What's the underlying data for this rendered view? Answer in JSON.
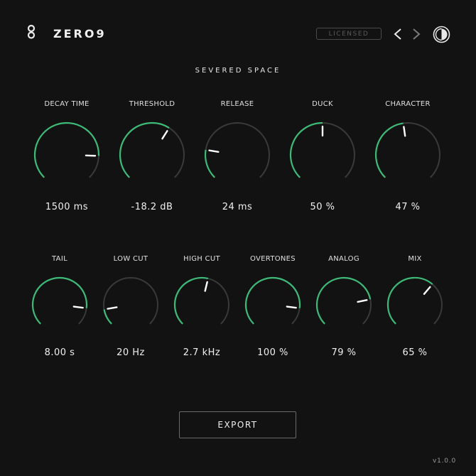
{
  "header": {
    "brand": "ZERO9",
    "license_badge": "LICENSED",
    "logo_icon": "infinity-logo-icon",
    "prev_icon": "chevron-left-icon",
    "next_icon": "chevron-right-icon",
    "theme_icon": "half-circle-theme-icon"
  },
  "preset": {
    "name": "SEVERED SPACE"
  },
  "colors": {
    "accent": "#3dba78",
    "track": "#3a3a3a",
    "background": "#121212",
    "pointer": "#ffffff"
  },
  "knobs_row1": [
    {
      "label": "DECAY TIME",
      "value": "1500 ms",
      "level": 0.84
    },
    {
      "label": "THRESHOLD",
      "value": "-18.2 dB",
      "level": 0.62
    },
    {
      "label": "RELEASE",
      "value": "24 ms",
      "level": 0.2
    },
    {
      "label": "DUCK",
      "value": "50 %",
      "level": 0.5
    },
    {
      "label": "CHARACTER",
      "value": "47 %",
      "level": 0.47
    }
  ],
  "knobs_row2": [
    {
      "label": "TAIL",
      "value": "8.00 s",
      "level": 0.86
    },
    {
      "label": "LOW CUT",
      "value": "20 Hz",
      "level": 0.13
    },
    {
      "label": "HIGH CUT",
      "value": "2.7 kHz",
      "level": 0.55
    },
    {
      "label": "OVERTONES",
      "value": "100 %",
      "level": 0.86
    },
    {
      "label": "ANALOG",
      "value": "79 %",
      "level": 0.79
    },
    {
      "label": "MIX",
      "value": "65 %",
      "level": 0.65
    }
  ],
  "footer": {
    "export_label": "EXPORT",
    "version": "v1.0.0"
  }
}
